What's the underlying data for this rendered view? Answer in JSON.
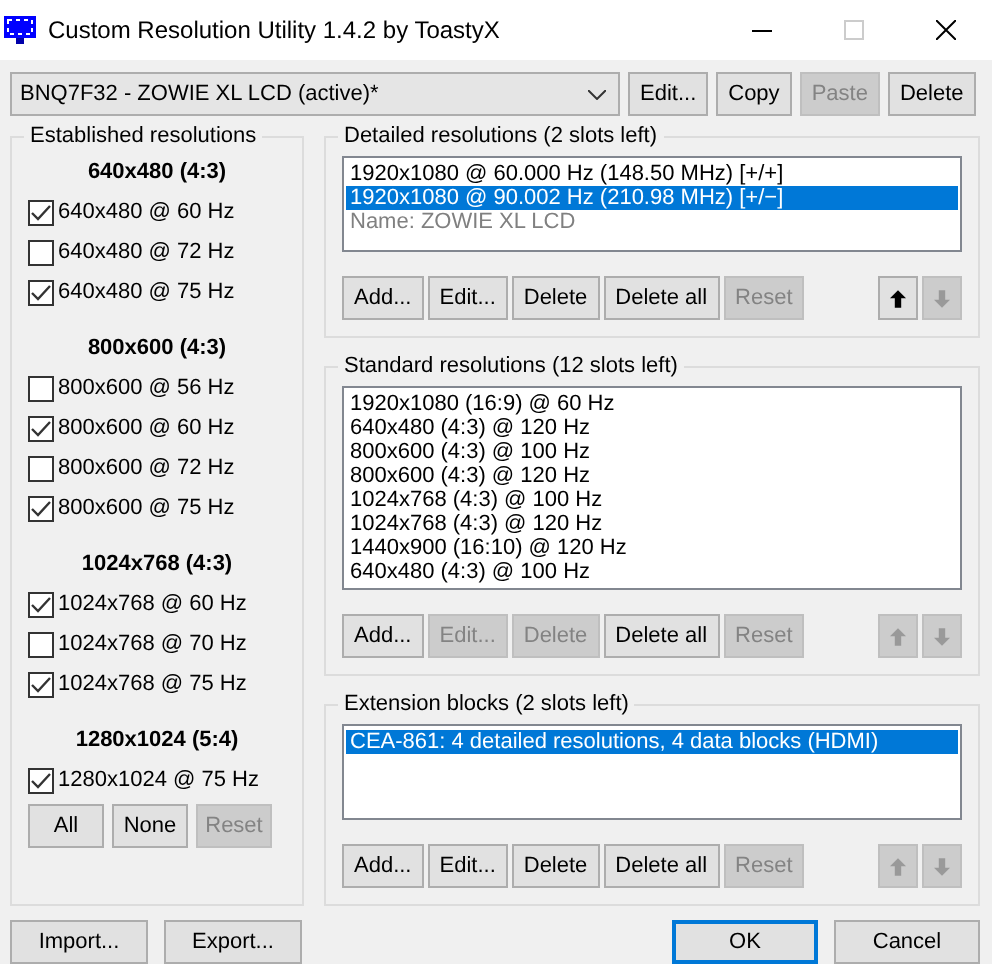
{
  "window": {
    "title": "Custom Resolution Utility 1.4.2 by ToastyX"
  },
  "monitor": {
    "value": "BNQ7F32 - ZOWIE XL LCD (active)*",
    "buttons": [
      {
        "label": "Edit...",
        "disabled": false
      },
      {
        "label": "Copy",
        "disabled": false
      },
      {
        "label": "Paste",
        "disabled": true
      },
      {
        "label": "Delete",
        "disabled": false
      }
    ]
  },
  "established": {
    "title": "Established resolutions",
    "groups": [
      {
        "heading": "640x480 (4:3)",
        "items": [
          {
            "label": "640x480 @ 60 Hz",
            "checked": true
          },
          {
            "label": "640x480 @ 72 Hz",
            "checked": false
          },
          {
            "label": "640x480 @ 75 Hz",
            "checked": true
          }
        ]
      },
      {
        "heading": "800x600 (4:3)",
        "items": [
          {
            "label": "800x600 @ 56 Hz",
            "checked": false
          },
          {
            "label": "800x600 @ 60 Hz",
            "checked": true
          },
          {
            "label": "800x600 @ 72 Hz",
            "checked": false
          },
          {
            "label": "800x600 @ 75 Hz",
            "checked": true
          }
        ]
      },
      {
        "heading": "1024x768 (4:3)",
        "items": [
          {
            "label": "1024x768 @ 60 Hz",
            "checked": true
          },
          {
            "label": "1024x768 @ 70 Hz",
            "checked": false
          },
          {
            "label": "1024x768 @ 75 Hz",
            "checked": true
          }
        ]
      },
      {
        "heading": "1280x1024 (5:4)",
        "items": [
          {
            "label": "1280x1024 @ 75 Hz",
            "checked": true
          }
        ]
      }
    ],
    "buttons": [
      {
        "label": "All",
        "disabled": false
      },
      {
        "label": "None",
        "disabled": false
      },
      {
        "label": "Reset",
        "disabled": true
      }
    ]
  },
  "sections": [
    {
      "title": "Detailed resolutions (2 slots left)",
      "items": [
        {
          "text": "1920x1080 @ 60.000 Hz (148.50 MHz) [+/+]",
          "kind": "entry",
          "selected": false
        },
        {
          "text": "1920x1080 @ 90.002 Hz (210.98 MHz) [+/−]",
          "kind": "entry",
          "selected": true
        },
        {
          "text": "Name: ZOWIE XL LCD",
          "kind": "name",
          "selected": false
        }
      ],
      "buttons": [
        {
          "label": "Add...",
          "disabled": false
        },
        {
          "label": "Edit...",
          "disabled": false
        },
        {
          "label": "Delete",
          "disabled": false
        },
        {
          "label": "Delete all",
          "disabled": false
        },
        {
          "label": "Reset",
          "disabled": true
        }
      ],
      "arrows": [
        {
          "disabled": false
        },
        {
          "disabled": true
        }
      ]
    },
    {
      "title": "Standard resolutions (12 slots left)",
      "items": [
        {
          "text": "1920x1080 (16:9) @ 60 Hz",
          "kind": "entry",
          "selected": false
        },
        {
          "text": "640x480 (4:3) @ 120 Hz",
          "kind": "entry",
          "selected": false
        },
        {
          "text": "800x600 (4:3) @ 100 Hz",
          "kind": "entry",
          "selected": false
        },
        {
          "text": "800x600 (4:3) @ 120 Hz",
          "kind": "entry",
          "selected": false
        },
        {
          "text": "1024x768 (4:3) @ 100 Hz",
          "kind": "entry",
          "selected": false
        },
        {
          "text": "1024x768 (4:3) @ 120 Hz",
          "kind": "entry",
          "selected": false
        },
        {
          "text": "1440x900 (16:10) @ 120 Hz",
          "kind": "entry",
          "selected": false
        },
        {
          "text": "640x480 (4:3) @ 100 Hz",
          "kind": "entry",
          "selected": false
        }
      ],
      "buttons": [
        {
          "label": "Add...",
          "disabled": false
        },
        {
          "label": "Edit...",
          "disabled": true
        },
        {
          "label": "Delete",
          "disabled": true
        },
        {
          "label": "Delete all",
          "disabled": false
        },
        {
          "label": "Reset",
          "disabled": true
        }
      ],
      "arrows": [
        {
          "disabled": true
        },
        {
          "disabled": true
        }
      ]
    },
    {
      "title": "Extension blocks (2 slots left)",
      "items": [
        {
          "text": "CEA-861: 4 detailed resolutions, 4 data blocks (HDMI)",
          "kind": "entry",
          "selected": true
        }
      ],
      "buttons": [
        {
          "label": "Add...",
          "disabled": false
        },
        {
          "label": "Edit...",
          "disabled": false
        },
        {
          "label": "Delete",
          "disabled": false
        },
        {
          "label": "Delete all",
          "disabled": false
        },
        {
          "label": "Reset",
          "disabled": true
        }
      ],
      "arrows": [
        {
          "disabled": true
        },
        {
          "disabled": true
        }
      ]
    }
  ],
  "footer": {
    "left": [
      {
        "label": "Import...",
        "default": false
      },
      {
        "label": "Export...",
        "default": false
      }
    ],
    "right": [
      {
        "label": "OK",
        "default": true
      },
      {
        "label": "Cancel",
        "default": false
      }
    ]
  }
}
